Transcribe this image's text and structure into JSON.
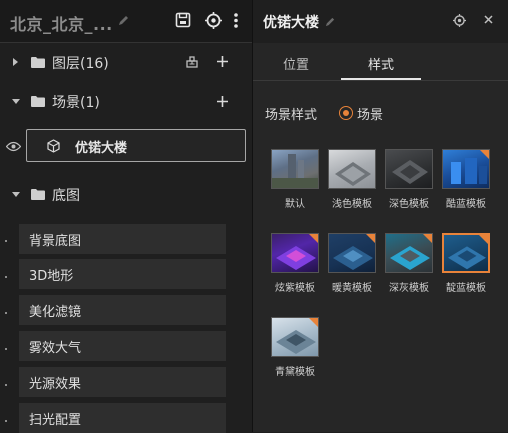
{
  "left_panel": {
    "title": "北京_北京_...",
    "layers": {
      "label": "图层(16)"
    },
    "scenes": {
      "label": "场景(1)",
      "item": "优锘大楼"
    },
    "basemap": {
      "label": "底图",
      "items": [
        "背景底图",
        "3D地形",
        "美化滤镜",
        "雾效大气",
        "光源效果",
        "扫光配置"
      ]
    }
  },
  "right_panel": {
    "title": "优锘大楼",
    "tabs": [
      {
        "label": "位置"
      },
      {
        "label": "样式"
      }
    ],
    "active_tab": "样式",
    "scene_style_label": "场景样式",
    "radio_label": "场景",
    "templates": [
      {
        "label": "默认"
      },
      {
        "label": "浅色模板"
      },
      {
        "label": "深色模板"
      },
      {
        "label": "酷蓝模板"
      },
      {
        "label": "炫紫模板"
      },
      {
        "label": "暖黄模板"
      },
      {
        "label": "深灰模板"
      },
      {
        "label": "靛蓝模板"
      },
      {
        "label": "青黛模板"
      }
    ],
    "selected_template": "靛蓝模板"
  },
  "colors": {
    "accent": "#e8833a",
    "panel_bg": "#262626",
    "left_bg": "#1f1f1f"
  }
}
